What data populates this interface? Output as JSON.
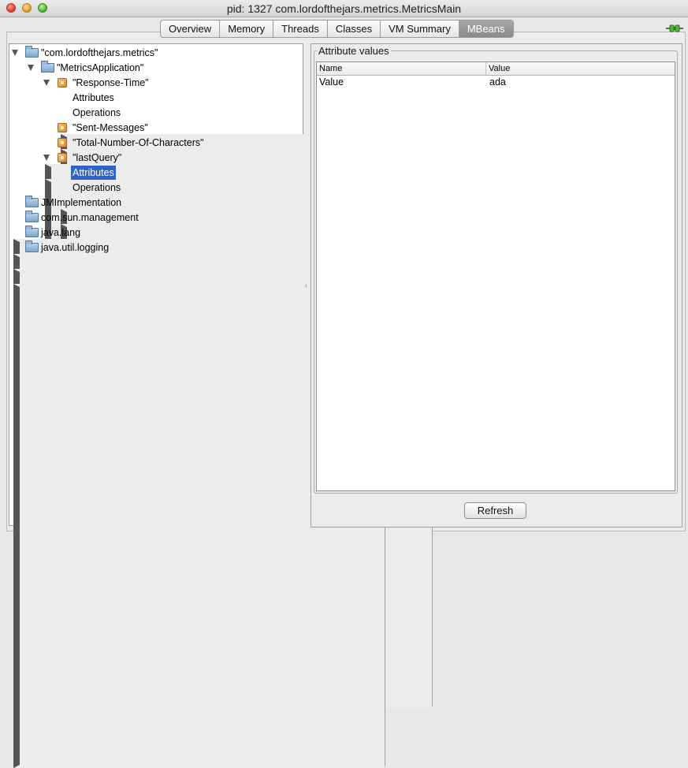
{
  "window": {
    "title": "pid: 1327 com.lordofthejars.metrics.MetricsMain"
  },
  "tabs": [
    {
      "label": "Overview",
      "active": false
    },
    {
      "label": "Memory",
      "active": false
    },
    {
      "label": "Threads",
      "active": false
    },
    {
      "label": "Classes",
      "active": false
    },
    {
      "label": "VM Summary",
      "active": false
    },
    {
      "label": "MBeans",
      "active": true
    }
  ],
  "connection_icon": "plug-icon",
  "tree": {
    "nodes": [
      {
        "label": "\"com.lordofthejars.metrics\"",
        "icon": "folder-icon",
        "state": "expanded"
      },
      {
        "label": "\"MetricsApplication\"",
        "icon": "folder-icon",
        "state": "expanded"
      },
      {
        "label": "\"Response-Time\"",
        "icon": "bean-icon",
        "state": "expanded"
      },
      {
        "label": "Attributes",
        "icon": "none",
        "state": "collapsed"
      },
      {
        "label": "Operations",
        "icon": "none",
        "state": "collapsed"
      },
      {
        "label": "\"Sent-Messages\"",
        "icon": "bean-icon",
        "state": "collapsed"
      },
      {
        "label": "\"Total-Number-Of-Characters\"",
        "icon": "bean-icon",
        "state": "collapsed"
      },
      {
        "label": "\"lastQuery\"",
        "icon": "bean-icon",
        "state": "expanded"
      },
      {
        "label": "Attributes",
        "icon": "none",
        "state": "collapsed",
        "selected": true
      },
      {
        "label": "Operations",
        "icon": "none",
        "state": "collapsed"
      },
      {
        "label": "JMImplementation",
        "icon": "folder-icon",
        "state": "collapsed"
      },
      {
        "label": "com.sun.management",
        "icon": "folder-icon",
        "state": "collapsed"
      },
      {
        "label": "java.lang",
        "icon": "folder-icon",
        "state": "collapsed"
      },
      {
        "label": "java.util.logging",
        "icon": "folder-icon",
        "state": "collapsed"
      }
    ]
  },
  "attributes_panel": {
    "title": "Attribute values",
    "columns": [
      "Name",
      "Value"
    ],
    "rows": [
      {
        "name": "Value",
        "value": "ada"
      }
    ],
    "refresh_label": "Refresh"
  }
}
